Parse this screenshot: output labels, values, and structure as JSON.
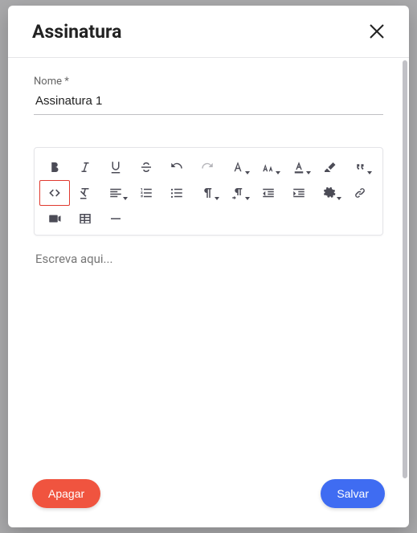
{
  "modal": {
    "title": "Assinatura",
    "name_label": "Nome *",
    "name_value": "Assinatura 1",
    "editor_placeholder": "Escreva aqui...",
    "delete_label": "Apagar",
    "save_label": "Salvar"
  },
  "toolbar": {
    "row1": [
      "bold",
      "italic",
      "underline",
      "strike",
      "undo",
      "redo",
      "font-family",
      "font-size",
      "text-color",
      "highlight",
      "quote"
    ],
    "row2": [
      "code",
      "clear-format",
      "align",
      "ordered-list",
      "unordered-list",
      "paragraph",
      "paragraph-dir",
      "outdent",
      "indent",
      "more",
      "link"
    ],
    "row3": [
      "video",
      "table",
      "hr"
    ]
  },
  "highlighted_tool": "code"
}
